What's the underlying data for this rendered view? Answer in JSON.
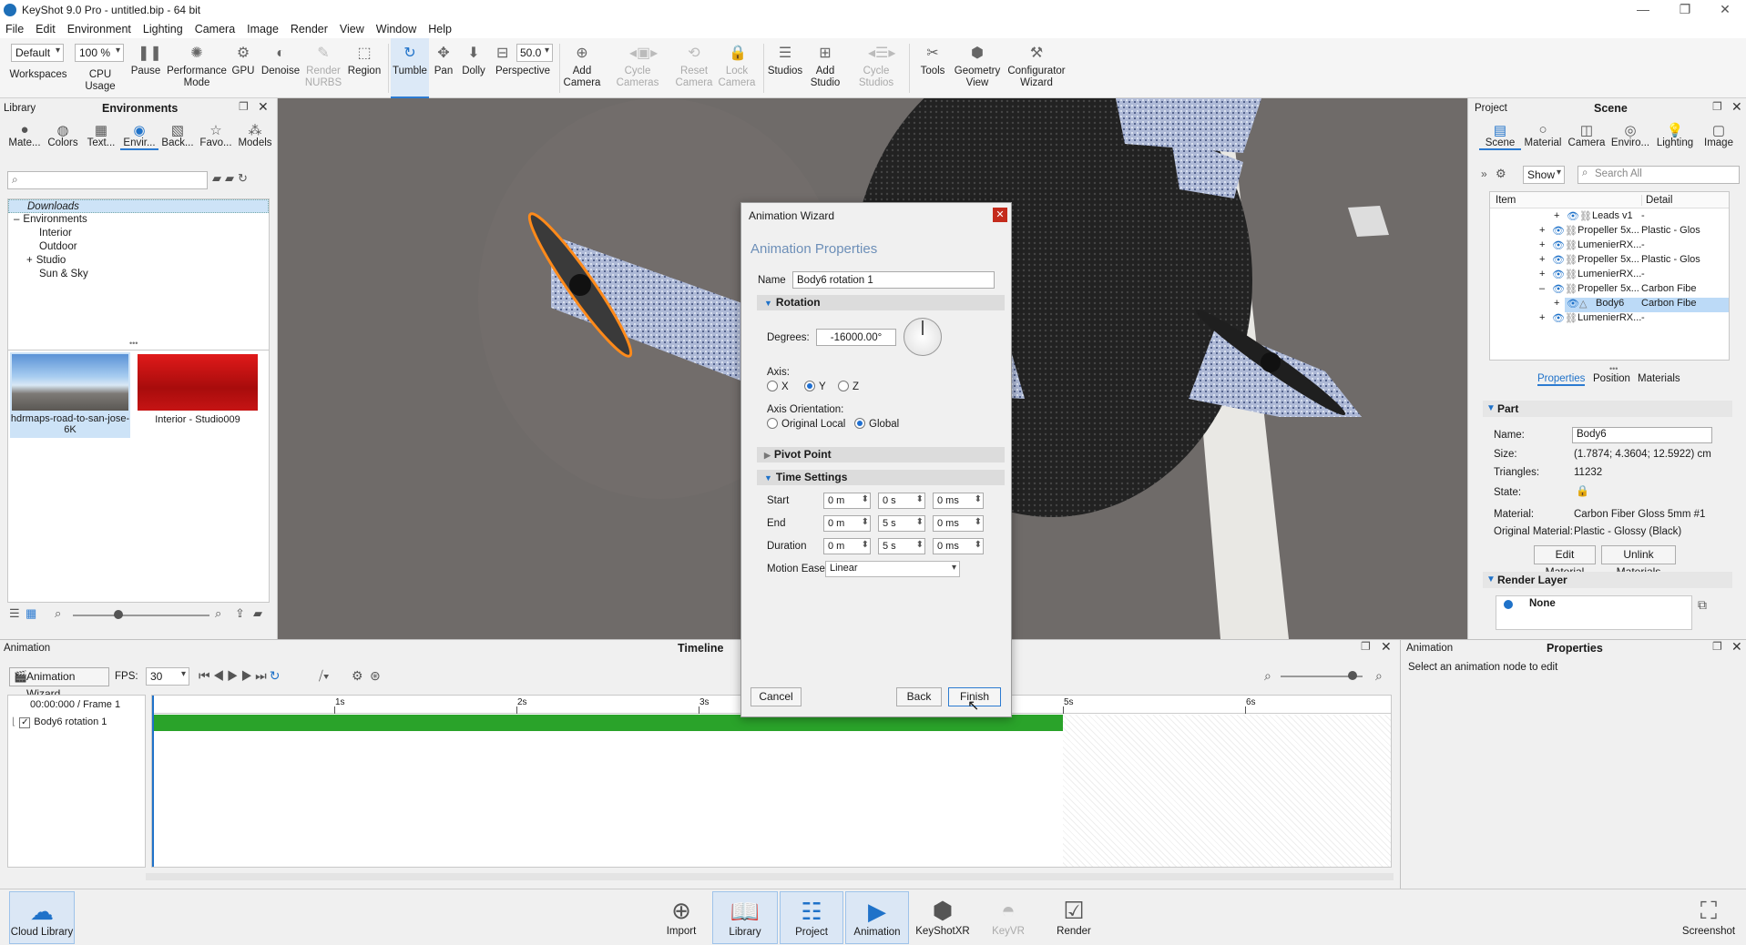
{
  "window": {
    "title": "KeyShot 9.0 Pro  -  untitled.bip  -  64 bit"
  },
  "menu": [
    "File",
    "Edit",
    "Environment",
    "Lighting",
    "Camera",
    "Image",
    "Render",
    "View",
    "Window",
    "Help"
  ],
  "toolbar": {
    "workspace_value": "Default",
    "zoom_value": "100 %",
    "perspective_value": "50.0",
    "buttons": {
      "workspaces": "Workspaces",
      "cpu_usage": "CPU Usage",
      "pause": "Pause",
      "performance": "Performance\nMode",
      "gpu": "GPU",
      "denoise": "Denoise",
      "render_nurbs": "Render\nNURBS",
      "region": "Region",
      "tumble": "Tumble",
      "pan": "Pan",
      "dolly": "Dolly",
      "perspective": "Perspective",
      "add_camera": "Add\nCamera",
      "cycle_cameras": "Cycle\nCameras",
      "reset_camera": "Reset\nCamera",
      "lock_camera": "Lock\nCamera",
      "studios": "Studios",
      "add_studio": "Add\nStudio",
      "cycle_studios": "Cycle\nStudios",
      "tools": "Tools",
      "geometry_view": "Geometry\nView",
      "configurator": "Configurator\nWizard"
    }
  },
  "library": {
    "label": "Library",
    "title": "Environments",
    "tabs": [
      "Mate...",
      "Colors",
      "Text...",
      "Envir...",
      "Back...",
      "Favo...",
      "Models"
    ],
    "tree": [
      "Downloads",
      "Environments",
      "Interior",
      "Outdoor",
      "Studio",
      "Sun & Sky"
    ],
    "thumbs": [
      "hdrmaps-road-to-san-jose-6K",
      "Interior - Studio009"
    ]
  },
  "project": {
    "label": "Project",
    "title": "Scene",
    "tabs": [
      "Scene",
      "Material",
      "Camera",
      "Enviro...",
      "Lighting",
      "Image"
    ],
    "show": "Show",
    "search_placeholder": "Search All",
    "col_item": "Item",
    "col_detail": "Detail",
    "rows": [
      {
        "name": "Leads v1",
        "detail": "-"
      },
      {
        "name": "Propeller 5x...",
        "detail": "Plastic - Glos"
      },
      {
        "name": "LumenierRX...",
        "detail": "-"
      },
      {
        "name": "Propeller 5x...",
        "detail": "Plastic - Glos"
      },
      {
        "name": "LumenierRX...",
        "detail": "-"
      },
      {
        "name": "Propeller 5x...",
        "detail": "Carbon Fibe"
      },
      {
        "name": "Body6",
        "detail": "Carbon Fibe"
      },
      {
        "name": "LumenierRX...",
        "detail": "-"
      }
    ],
    "subtabs": [
      "Properties",
      "Position",
      "Materials"
    ],
    "part": {
      "header": "Part",
      "name_label": "Name:",
      "name": "Body6",
      "size_label": "Size:",
      "size": "(1.7874; 4.3604; 12.5922) cm",
      "tri_label": "Triangles:",
      "tri": "11232",
      "state_label": "State:",
      "mat_label": "Material:",
      "mat": "Carbon Fiber Gloss 5mm #1",
      "orig_label": "Original Material:",
      "orig": "Plastic - Glossy (Black)",
      "edit_btn": "Edit Material",
      "unlink_btn": "Unlink Materials"
    },
    "render_layer": {
      "header": "Render Layer",
      "value": "None"
    }
  },
  "dialog": {
    "title": "Animation Wizard",
    "heading": "Animation Properties",
    "name_label": "Name",
    "name_value": "Body6 rotation 1",
    "rotation": "Rotation",
    "degrees_label": "Degrees:",
    "degrees_value": "-16000.00°",
    "axis_label": "Axis:",
    "axes": [
      "X",
      "Y",
      "Z"
    ],
    "orient_label": "Axis Orientation:",
    "orients": [
      "Original Local",
      "Global"
    ],
    "pivot": "Pivot Point",
    "time": "Time Settings",
    "start_label": "Start",
    "end_label": "End",
    "duration_label": "Duration",
    "start": [
      "0 m",
      "0 s",
      "0 ms"
    ],
    "end": [
      "0 m",
      "5 s",
      "0 ms"
    ],
    "duration": [
      "0 m",
      "5 s",
      "0 ms"
    ],
    "ease_label": "Motion Ease",
    "ease_value": "Linear",
    "cancel": "Cancel",
    "back": "Back",
    "finish": "Finish"
  },
  "animation": {
    "label": "Animation",
    "title": "Timeline",
    "wizard_btn": "Animation Wizard",
    "fps_label": "FPS:",
    "fps": "30",
    "frame": "00:00:000 / Frame 1",
    "track": "Body6 rotation 1",
    "ticks": [
      "1s",
      "2s",
      "3s",
      "5s",
      "6s"
    ]
  },
  "anim_props": {
    "label": "Animation",
    "title": "Properties",
    "hint": "Select an animation node to edit"
  },
  "bottom": {
    "cloud": "Cloud Library",
    "import": "Import",
    "library": "Library",
    "project": "Project",
    "animation": "Animation",
    "keyshotxr": "KeyShotXR",
    "keyvr": "KeyVR",
    "render": "Render",
    "screenshot": "Screenshot"
  }
}
